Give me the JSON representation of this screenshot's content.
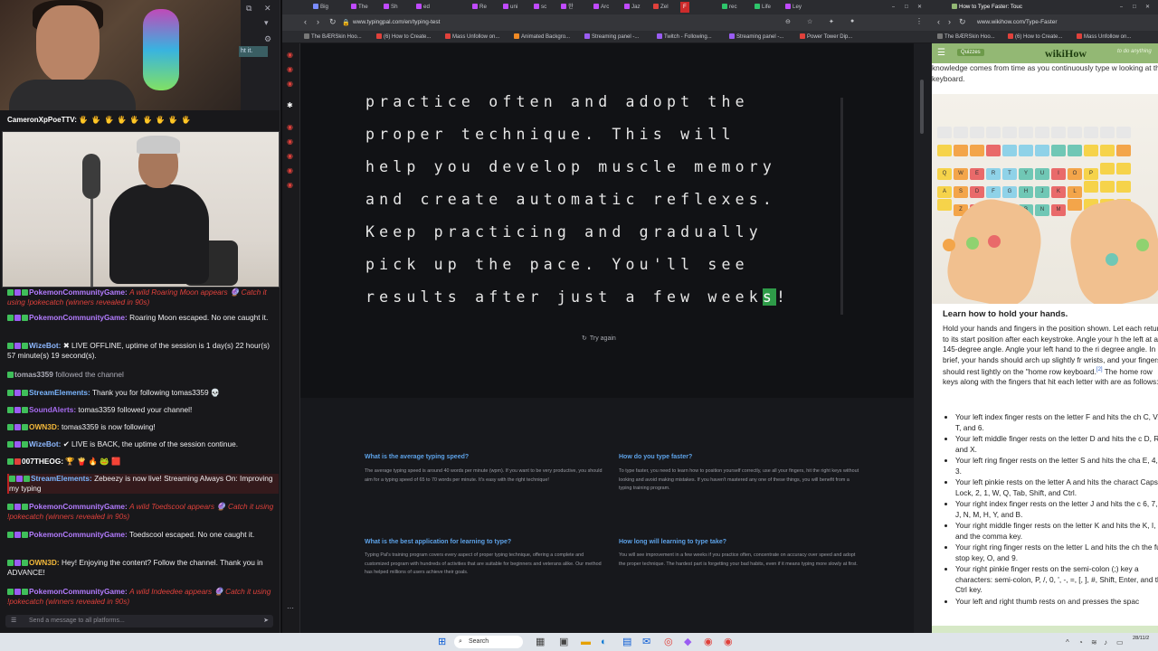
{
  "stream": {
    "popup_fragment": "ht it.",
    "top_chat_user": "CameronXpPoeTTV:",
    "top_chat_emotes": "🖐 🖐 🖐 🖐 🖐 🖐 🖐 🖐 🖐",
    "chat": [
      {
        "user": "PokemonCommunityGame:",
        "text": "A wild Roaring Moon appears 🔮 Catch it using !pokecatch (winners revealed in 90s)"
      },
      {
        "user": "PokemonCommunityGame:",
        "text": "Roaring Moon escaped. No one caught it."
      },
      {
        "user": "WizeBot:",
        "text": "✖ LIVE OFFLINE, uptime of the session is 1 day(s) 22 hour(s) 57 minute(s) 19 second(s)."
      },
      {
        "user": "tomas3359",
        "text": "followed the channel"
      },
      {
        "user": "StreamElements:",
        "text": "Thank you for following tomas3359 💀"
      },
      {
        "user": "SoundAlerts:",
        "text": "tomas3359 followed your channel!"
      },
      {
        "user": "OWN3D:",
        "text": "tomas3359 is now following!"
      },
      {
        "user": "WizeBot:",
        "text": "✔ LIVE is BACK, the uptime of the session continue."
      },
      {
        "user": "007THEOG:",
        "text": "🏆 🍟 🔥 🐸 🟥"
      },
      {
        "user": "StreamElements:",
        "text": "Zebeezy is now live! Streaming Always On: Improving my typing"
      },
      {
        "user": "PokemonCommunityGame:",
        "text": "A wild Toedscool appears 🔮 Catch it using !pokecatch (winners revealed in 90s)"
      },
      {
        "user": "PokemonCommunityGame:",
        "text": "Toedscool escaped. No one caught it."
      },
      {
        "user": "OWN3D:",
        "text": "Hey! Enjoying the content? Follow the channel. Thank you in ADVANCE!"
      },
      {
        "user": "PokemonCommunityGame:",
        "text": "A wild Indeedee appears 🔮 Catch it using !pokecatch (winners revealed in 90s)"
      }
    ],
    "chat_input_placeholder": "Send a message to all platforms..."
  },
  "browser1": {
    "tabs": [
      "Big",
      "The",
      "Sh",
      "ed",
      "Re",
      "uni",
      "sc",
      "한",
      "Arc",
      "Jaz",
      "Zel",
      "F",
      "rec",
      "Life",
      "Ley"
    ],
    "url": "www.typingpal.com/en/typing-test",
    "bookmarks": [
      "The BÆRSkin Hoo...",
      "(6) How to Create...",
      "Mass Unfollow on...",
      "Animated Backgro...",
      "Streaming panel -...",
      "Twitch - Following...",
      "Streaming panel -...",
      "Power Tower Dip..."
    ]
  },
  "typing": {
    "lines": [
      "practice often and adopt the",
      "proper technique. This will",
      "help you develop muscle memory",
      "and create automatic reflexes.",
      "Keep practicing and gradually",
      "pick up the pace. You'll see"
    ],
    "last_line_before": "results after just a few week",
    "current_char": "s",
    "last_line_after": "!",
    "try_again": "Try again",
    "accent": "#2e9b48"
  },
  "faq": [
    {
      "q": "What is the average typing speed?",
      "a": "The average typing speed is around 40 words per minute (wpm). If you want to be very productive, you should aim for a typing speed of 65 to 70 words per minute. It's easy with the right technique!"
    },
    {
      "q": "How do you type faster?",
      "a": "To type faster, you need to learn how to position yourself correctly, use all your fingers, hit the right keys without looking and avoid making mistakes. If you haven't mastered any one of these things, you will benefit from a typing training program."
    },
    {
      "q": "What is the best application for learning to type?",
      "a": "Typing Pal's training program covers every aspect of proper typing technique, offering a complete and customized program with hundreds of activities that are suitable for beginners and veterans alike. Our method has helped millions of users achieve their goals."
    },
    {
      "q": "How long will learning to type take?",
      "a": "You will see improvement in a few weeks if you practice often, concentrate on accuracy over speed and adopt the proper technique. The hardest part is forgetting your bad habits, even if it means typing more slowly at first."
    }
  ],
  "browser2": {
    "tab": "How to Type Faster: Touc",
    "url": "www.wikihow.com/Type-Faster",
    "bookmarks": [
      "The BÆRSkin Hoo...",
      "(6) How to Create...",
      "Mass Unfollow on..."
    ]
  },
  "wikihow": {
    "logo": "wikiHow",
    "quiz": "Quizzes",
    "search": "to do anything",
    "intro": "knowledge comes from time as you continuously type w looking at the keyboard.",
    "step_title": "Learn how to hold your hands.",
    "step_text": "Hold your hands and fingers in the position shown. Let each return to its start position after each keystroke. Angle your h the left at a 145-degree angle. Angle your left hand to the ri degree angle. In brief, your hands should arch up slightly fr wrists, and your fingers should rest lightly on the \"home row keyboard.",
    "cite": "[2]",
    "step_text2": "The home row keys along with the fingers that hit each letter with are as follows:",
    "list": [
      "Your left index finger rests on the letter F and hits the ch C, V, G, T, and 6.",
      "Your left middle finger rests on the letter D and hits the c D, R, 5, and X.",
      "Your left ring finger rests on the letter S and hits the cha E, 4, and 3.",
      "Your left pinkie rests on the letter A and hits the charact Caps Lock, 2, 1, W, Q, Tab, Shift, and Ctrl.",
      "Your right index finger rests on the letter J and hits the c 6, 7, U, J, N, M, H, Y, and B.",
      "Your right middle finger rests on the letter K and hits the K, I, 8, and the comma key.",
      "Your right ring finger rests on the letter L and hits the ch the full stop key, O, and 9.",
      "Your right pinkie finger rests on the semi-colon (;) key a characters: semi-colon, P, /, 0, ', -, =, [, ], #, Shift, Enter, and the Ctrl key.",
      "Your left and right thumb rests on and presses the spac"
    ]
  },
  "taskbar": {
    "search": "Search",
    "time": "",
    "date": "28/11/2"
  }
}
